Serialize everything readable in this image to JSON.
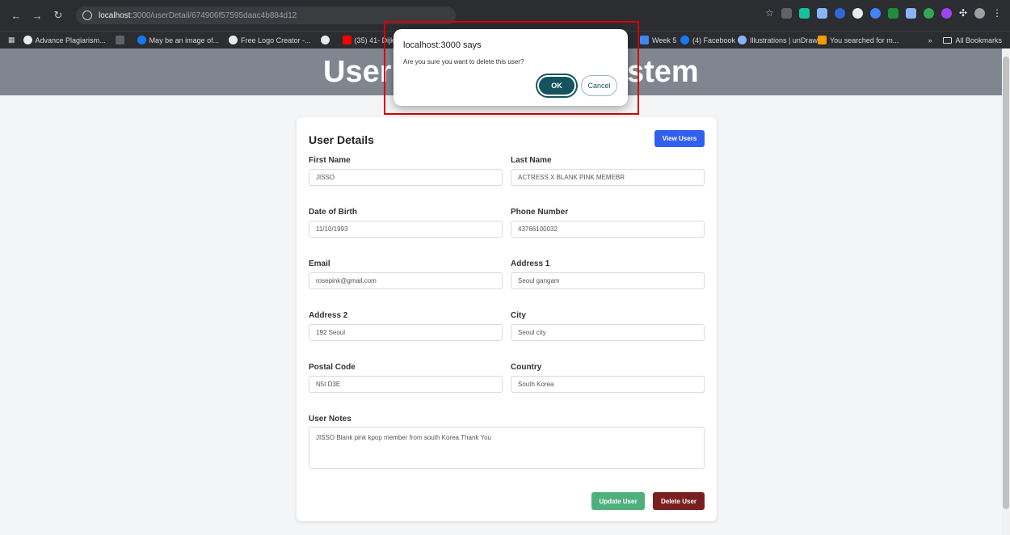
{
  "browser": {
    "url_host": "localhost",
    "url_path": ":3000/userDetail/674906f57595daac4b884d12",
    "bookmarks": [
      "Advance Plagiarism...",
      "May be an image of...",
      "Free Logo Creator -...",
      "(35) 41- Dijkstra's Al...",
      "Week 5",
      "(4) Facebook",
      "Illustrations | unDraw",
      "You searched for m..."
    ],
    "bookmarks_overflow": "»",
    "all_bookmarks": "All Bookmarks"
  },
  "page": {
    "title_left": "User",
    "title_right": "stem"
  },
  "card": {
    "title": "User Details",
    "view_users_label": "View Users",
    "fields": {
      "first_name": {
        "label": "First Name",
        "value": "JISSO"
      },
      "last_name": {
        "label": "Last Name",
        "value": "ACTRESS X BLANK PINK MEMEBR"
      },
      "dob": {
        "label": "Date of Birth",
        "value": "11/10/1993"
      },
      "phone": {
        "label": "Phone Number",
        "value": "43766100032"
      },
      "email": {
        "label": "Email",
        "value": "rosepink@gmail.com"
      },
      "address1": {
        "label": "Address 1",
        "value": "Seoul gangam"
      },
      "address2": {
        "label": "Address 2",
        "value": "192 Seoul"
      },
      "city": {
        "label": "City",
        "value": "Seoul city"
      },
      "postal": {
        "label": "Postal Code",
        "value": "N5t D3E"
      },
      "country": {
        "label": "Country",
        "value": "South Korea"
      },
      "notes": {
        "label": "User Notes",
        "value": "JISSO Blank pink kpop member from south Korea.Thank You"
      }
    },
    "update_label": "Update User",
    "delete_label": "Delete User"
  },
  "dialog": {
    "title": "localhost:3000 says",
    "message": "Are you sure you want to delete this user?",
    "ok_label": "OK",
    "cancel_label": "Cancel"
  },
  "colors": {
    "primary": "#3160f0",
    "success": "#4fb07e",
    "danger": "#7a1f1f",
    "dialog_accent": "#15545e",
    "highlight": "#d40000"
  }
}
